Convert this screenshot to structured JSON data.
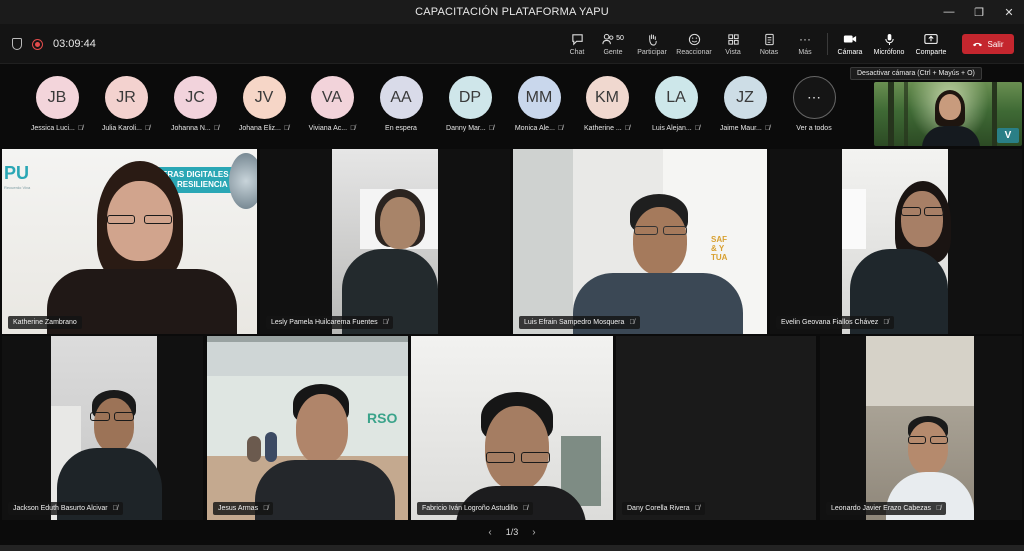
{
  "window": {
    "title": "CAPACITACIÓN PLATAFORMA YAPU",
    "controls": [
      "—",
      "❐",
      "✕"
    ]
  },
  "meeting": {
    "timer": "03:09:44"
  },
  "toolbar": {
    "chat": "Chat",
    "people": "Gente",
    "people_count": "50",
    "participate": "Participar",
    "react": "Reaccionar",
    "view": "Vista",
    "notes": "Notas",
    "more": "Más",
    "camera": "Cámara",
    "mic": "Micrófono",
    "share": "Comparte",
    "leave": "Salir"
  },
  "tooltip": "Desactivar cámara (Ctrl + Mayús + O)",
  "participants": [
    {
      "initials": "JB",
      "name": "Jessica Luci...",
      "color": "#f3d5db"
    },
    {
      "initials": "JR",
      "name": "Julia Karoli...",
      "color": "#f3d2cf"
    },
    {
      "initials": "JC",
      "name": "Johanna N...",
      "color": "#f2d3dc"
    },
    {
      "initials": "JV",
      "name": "Johana Eliz...",
      "color": "#f6d6c7"
    },
    {
      "initials": "VA",
      "name": "Viviana Ac...",
      "color": "#f2d3da"
    },
    {
      "initials": "AA",
      "name": "En espera",
      "color": "#d9dbe9"
    },
    {
      "initials": "DP",
      "name": "Danny Mar...",
      "color": "#cfe6ea"
    },
    {
      "initials": "MM",
      "name": "Monica Ale...",
      "color": "#c9d7ec"
    },
    {
      "initials": "KM",
      "name": "Katherine ...",
      "color": "#f0d8cf"
    },
    {
      "initials": "LA",
      "name": "Luis Alejan...",
      "color": "#cde7ea"
    },
    {
      "initials": "JZ",
      "name": "Jaime Maur...",
      "color": "#cddde6"
    }
  ],
  "see_all": "Ver a todos",
  "see_all_icon": "⋯",
  "tiles": [
    {
      "name": "Katherine Zambrano",
      "banner_line1": "ERAS DIGITALES",
      "banner_line2": "RESILIENCIA",
      "logo": "PU",
      "logo_sub": "Recuerdo Viva"
    },
    {
      "name": "Lesly Pamela Huilcarema Fuentes"
    },
    {
      "name": "Luis Efrain Sampedro Mosquera",
      "wall_text": "SAF\n& Y\nTUA"
    },
    {
      "name": "Evelin Geovana Fiallos Chávez"
    },
    {
      "name": "Jackson Eduth Basurto Alcivar"
    },
    {
      "name": "Jesus Armas",
      "wall_text": "RSO"
    },
    {
      "name": "Fabricio Iván Logroño Astudillo"
    },
    {
      "name": "Dany Corella Rivera"
    },
    {
      "name": "Leonardo Javier Erazo Cabezas"
    }
  ],
  "pagination": {
    "label": "1/3",
    "prev": "‹",
    "next": "›"
  }
}
